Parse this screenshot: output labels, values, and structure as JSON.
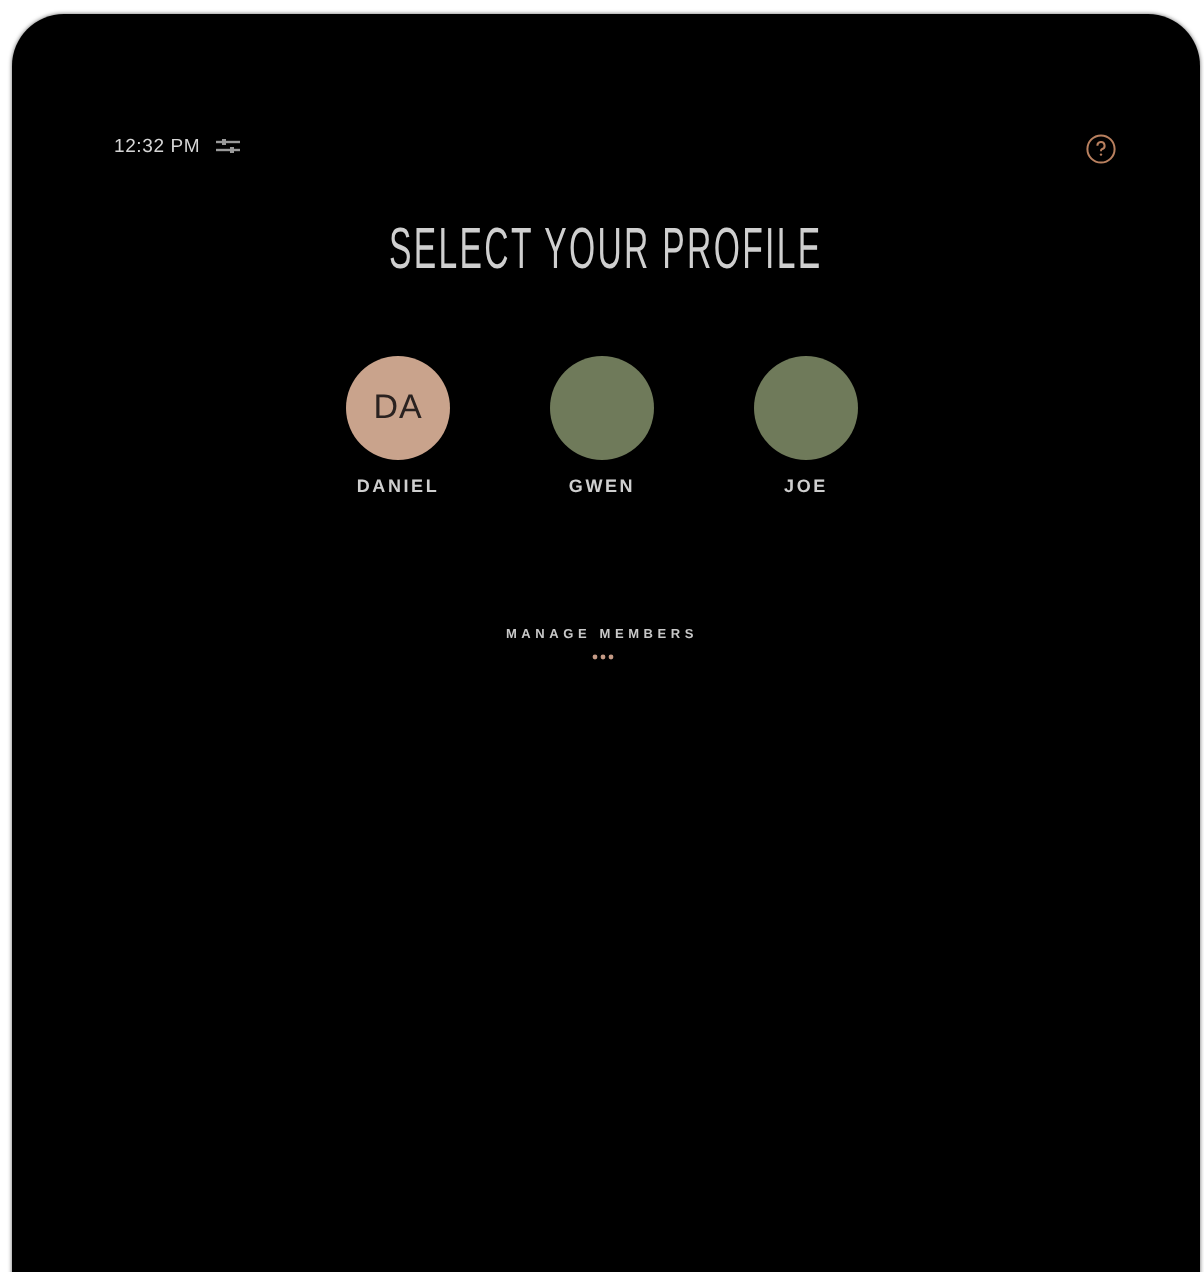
{
  "status_bar": {
    "time": "12:32 PM"
  },
  "title": "SELECT YOUR PROFILE",
  "profiles": [
    {
      "kind": "initials",
      "initials": "DA",
      "name": "DANIEL"
    },
    {
      "kind": "photo",
      "name": "GWEN"
    },
    {
      "kind": "photo",
      "name": "JOE"
    }
  ],
  "manage": {
    "label": "MANAGE MEMBERS"
  }
}
